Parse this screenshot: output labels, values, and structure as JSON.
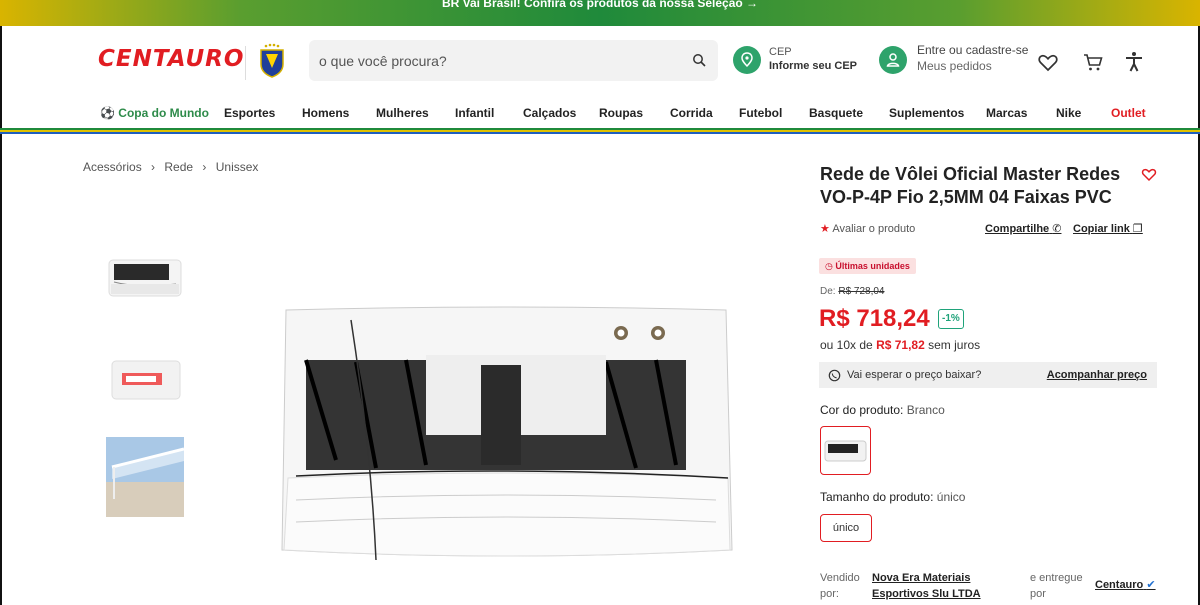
{
  "promo": {
    "text": "BR Vai Brasil!  Confira os produtos da nossa Seleção →"
  },
  "header": {
    "logo_text": "CENTAURO",
    "search": {
      "placeholder": "o que você procura?"
    },
    "cep": {
      "label": "CEP",
      "value": "Informe seu CEP"
    },
    "account": {
      "line1": "Entre ou cadastre-se",
      "line2": "Meus pedidos"
    },
    "icons": [
      "heart-icon",
      "cart-icon",
      "accessibility-icon"
    ]
  },
  "nav": {
    "items": [
      {
        "label": "Copa do Mundo"
      },
      {
        "label": "Esportes"
      },
      {
        "label": "Homens"
      },
      {
        "label": "Mulheres"
      },
      {
        "label": "Infantil"
      },
      {
        "label": "Calçados"
      },
      {
        "label": "Roupas"
      },
      {
        "label": "Corrida"
      },
      {
        "label": "Futebol"
      },
      {
        "label": "Basquete"
      },
      {
        "label": "Suplementos"
      },
      {
        "label": "Marcas"
      },
      {
        "label": "Nike"
      },
      {
        "label": "Outlet"
      }
    ]
  },
  "breadcrumb": {
    "items": [
      "Acessórios",
      "Rede",
      "Unissex"
    ],
    "separator": "›"
  },
  "product": {
    "title": "Rede de Vôlei Oficial Master Redes VO-P-4P Fio 2,5MM 04 Faixas PVC",
    "rate_label": "Avaliar o produto",
    "share_label": "Compartilhe",
    "copy_label": "Copiar link",
    "badge": "Últimas unidades",
    "old_price_prefix": "De:",
    "old_price": "R$ 728,04",
    "price": "R$ 718,24",
    "discount": "-1%",
    "installments_prefix": "ou 10x de",
    "installments_value": "R$ 71,82",
    "installments_suffix": "sem juros",
    "price_alert": {
      "text": "Vai esperar o preço baixar?",
      "link": "Acompanhar preço"
    },
    "color": {
      "label": "Cor do produto:",
      "value": "Branco"
    },
    "size": {
      "label": "Tamanho do produto:",
      "value": "único",
      "option": "único"
    },
    "seller": {
      "sold_by_label": "Vendido por:",
      "seller_name": "Nova Era Materiais Esportivos Slu LTDA",
      "delivered_label": "e entregue por",
      "delivered_by": "Centauro"
    }
  },
  "colors": {
    "brand_red": "#e11d22",
    "green": "#2ea36b",
    "teal": "#1fa37a"
  }
}
